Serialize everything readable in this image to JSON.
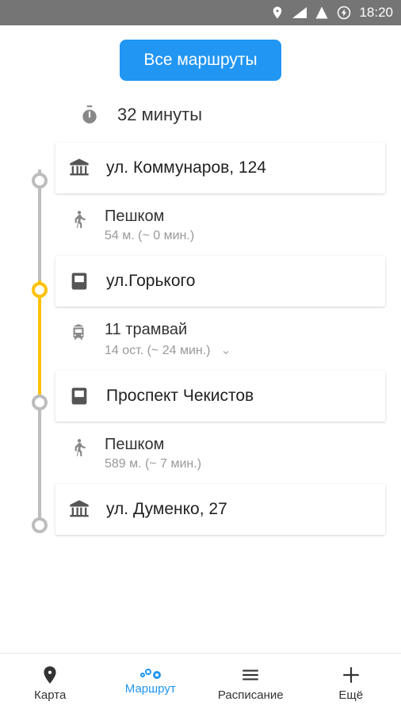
{
  "status": {
    "time": "18:20"
  },
  "header": {
    "all_routes": "Все маршруты"
  },
  "duration": {
    "label": "32 минуты"
  },
  "route": {
    "stops": [
      {
        "title": "ул. Коммунаров, 124"
      },
      {
        "title": "ул.Горького"
      },
      {
        "title": "Проспект Чекистов"
      },
      {
        "title": "ул. Думенко, 27"
      }
    ],
    "steps": [
      {
        "title": "Пешком",
        "sub": "54 м. (~ 0 мин.)"
      },
      {
        "title": "11 трамвай",
        "sub": "14 ост. (~ 24 мин.)"
      },
      {
        "title": "Пешком",
        "sub": "589 м. (~ 7 мин.)"
      }
    ]
  },
  "nav": {
    "map": "Карта",
    "route": "Маршрут",
    "schedule": "Расписание",
    "more": "Ещё"
  },
  "colors": {
    "accent": "#2196F3",
    "gray": "#9E9E9E",
    "yellow": "#FFC107"
  }
}
